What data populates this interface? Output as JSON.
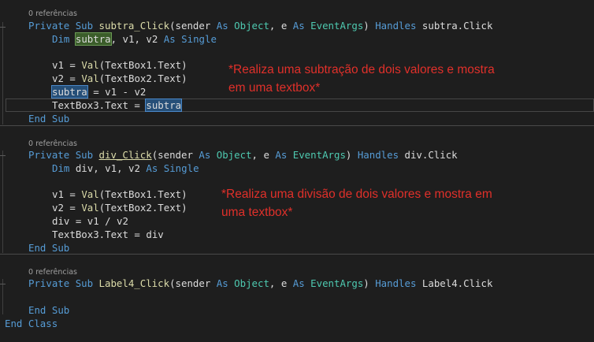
{
  "codelens": {
    "refs1": "0 referências",
    "refs2": "0 referências",
    "refs3": "0 referências"
  },
  "sub1": {
    "private": "Private",
    "sub": "Sub",
    "name": "subtra_Click",
    "paren_open": "(sender ",
    "as1": "As",
    "object": "Object",
    "comma_e": ", e ",
    "as2": "As",
    "eventargs": "EventArgs",
    "paren_close": ") ",
    "handles": "Handles",
    "handler": " subtra.Click",
    "dim": "Dim",
    "dim_var": "subtra",
    "dim_rest": ", v1, v2 ",
    "dim_as": "As",
    "dim_type": "Single",
    "l1_pre": "v1 = ",
    "l1_fn": "Val",
    "l1_post": "(TextBox1.Text)",
    "l2_pre": "v2 = ",
    "l2_fn": "Val",
    "l2_post": "(TextBox2.Text)",
    "l3_var": "subtra",
    "l3_post": " = v1 - v2",
    "l4_pre": "TextBox3.Text = ",
    "l4_var": "subtra",
    "end": "End",
    "end_sub": "Sub"
  },
  "sub2": {
    "private": "Private",
    "sub": "Sub",
    "name": "div_Click",
    "paren_open": "(sender ",
    "as1": "As",
    "object": "Object",
    "comma_e": ", e ",
    "as2": "As",
    "eventargs": "EventArgs",
    "paren_close": ") ",
    "handles": "Handles",
    "handler": " div.Click",
    "dim": "Dim",
    "dim_rest": " div, v1, v2 ",
    "dim_as": "As",
    "dim_type": "Single",
    "l1_pre": "v1 = ",
    "l1_fn": "Val",
    "l1_post": "(TextBox1.Text)",
    "l2_pre": "v2 = ",
    "l2_fn": "Val",
    "l2_post": "(TextBox2.Text)",
    "l3": "div = v1 / v2",
    "l4": "TextBox3.Text = div",
    "end": "End",
    "end_sub": "Sub"
  },
  "sub3": {
    "private": "Private",
    "sub": "Sub",
    "name": "Label4_Click",
    "paren_open": "(sender ",
    "as1": "As",
    "object": "Object",
    "comma_e": ", e ",
    "as2": "As",
    "eventargs": "EventArgs",
    "paren_close": ") ",
    "handles": "Handles",
    "handler": " Label4.Click",
    "end": "End",
    "end_sub": "Sub"
  },
  "end_class": {
    "end": "End",
    "class": "Class"
  },
  "annotations": {
    "comment1_line1": "*Realiza uma subtração de dois valores e mostra",
    "comment1_line2": "em uma textbox*",
    "comment2_line1": "*Realiza uma divisão de dois valores e mostra em",
    "comment2_line2": "uma textbox*"
  },
  "colors": {
    "background": "#1e1e1e",
    "keyword": "#569cd6",
    "type": "#4ec9b0",
    "function": "#dcdcaa",
    "identifier": "#dcdcdc",
    "annotation": "#e0302a"
  }
}
